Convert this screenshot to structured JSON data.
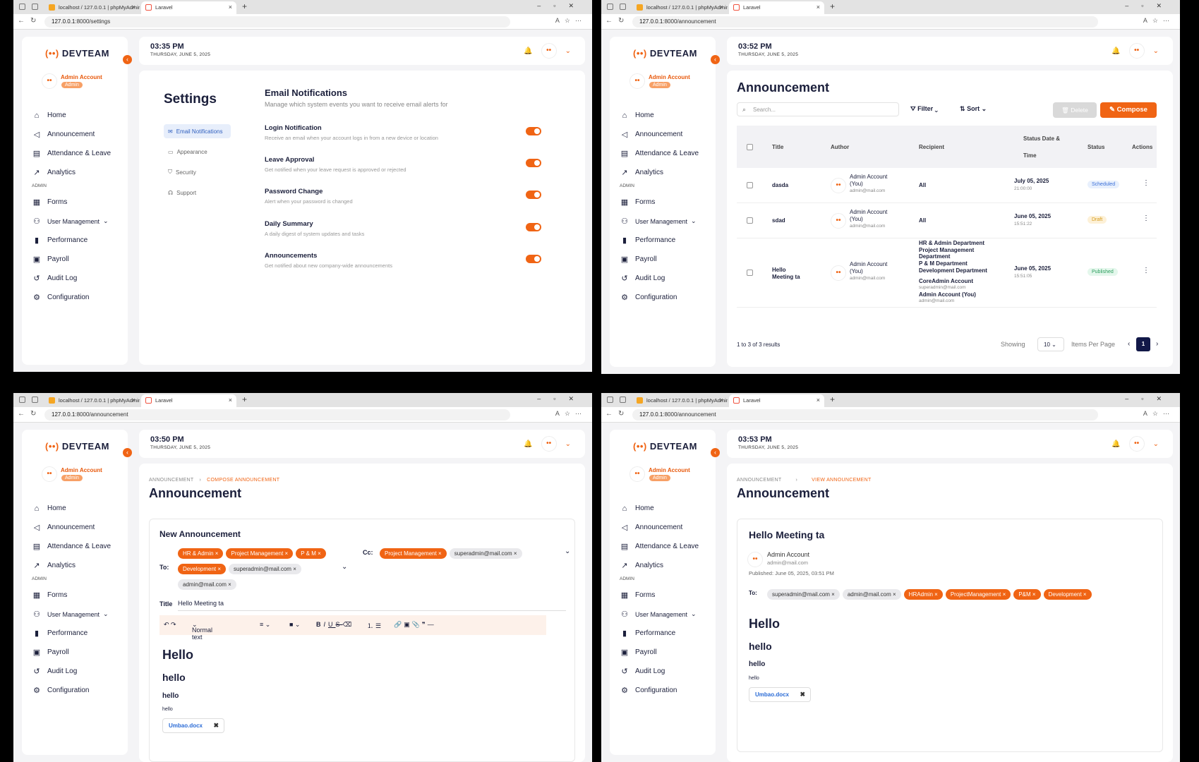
{
  "browser": {
    "tab1": "localhost / 127.0.0.1 | phpMyAdmin",
    "tab2": "Laravel",
    "url_host": "127.0.0.1",
    "url_settings": ":8000/settings",
    "url_announcement": ":8000/announcement"
  },
  "brand": {
    "prefix": "(••)",
    "name": "DEVTEAM",
    "accent": "#f06414"
  },
  "profile": {
    "name": "Admin Account",
    "role": "Admin"
  },
  "menu": {
    "home": "Home",
    "announcement": "Announcement",
    "attendance": "Attendance & Leave",
    "analytics": "Analytics",
    "admin_section": "ADMIN",
    "forms": "Forms",
    "user_mgmt": "User Management",
    "performance": "Performance",
    "payroll": "Payroll",
    "audit": "Audit Log",
    "configuration": "Configuration"
  },
  "date": "THURSDAY, JUNE 5, 2025",
  "q1": {
    "time": "03:35 PM",
    "title": "Settings",
    "nav": [
      "Email Notifications",
      "Appearance",
      "Security",
      "Support"
    ],
    "section_title": "Email Notifications",
    "section_sub": "Manage which system events you want to receive email alerts for",
    "options": [
      {
        "title": "Login Notification",
        "desc": "Receive an email when your account logs in from a new device or location",
        "enabled": true
      },
      {
        "title": "Leave Approval",
        "desc": "Get notified when your leave request is approved or rejected",
        "enabled": true
      },
      {
        "title": "Password Change",
        "desc": "Alert when your password is changed",
        "enabled": true
      },
      {
        "title": "Daily Summary",
        "desc": "A daily digest of system updates and tasks",
        "enabled": true
      },
      {
        "title": "Announcements",
        "desc": "Get notified about new company-wide announcements",
        "enabled": true
      }
    ]
  },
  "q2": {
    "time": "03:52 PM",
    "title": "Announcement",
    "search_placeholder": "Search...",
    "filter": "Filter",
    "sort": "Sort",
    "delete": "Delete",
    "compose": "Compose",
    "columns": {
      "title": "Title",
      "author": "Author",
      "recipient": "Recipient",
      "status_date_1": "Status Date &",
      "status_date_2": "Time",
      "status": "Status",
      "actions": "Actions"
    },
    "rows": [
      {
        "title": "dasda",
        "author1": "Admin Account",
        "author2": "(You)",
        "email": "admin@mail.com",
        "recipient": "All",
        "date": "July 05, 2025",
        "time": "21:00:00",
        "status": "Scheduled"
      },
      {
        "title": "sdad",
        "author1": "Admin Account",
        "author2": "(You)",
        "email": "admin@mail.com",
        "recipient": "All",
        "date": "June 05, 2025",
        "time": "15:51:22",
        "status": "Draft"
      },
      {
        "title1": "Hello",
        "title2": "Meeting ta",
        "author1": "Admin Account",
        "author2": "(You)",
        "email": "admin@mail.com",
        "recipients": [
          "HR & Admin Department",
          "Project Management",
          "Department",
          "P & M Department",
          "Development Department"
        ],
        "user1": "CoreAdmin Account",
        "user1_email": "superadmin@mail.com",
        "user2": "Admin Account (You)",
        "user2_email": "admin@mail.com",
        "date": "June 05, 2025",
        "time": "15:51:05",
        "status": "Published"
      }
    ],
    "results": "1 to 3 of 3 results",
    "showing": "Showing",
    "per_page": "10",
    "items_per_page": "Items Per Page",
    "page": "1"
  },
  "q3": {
    "time": "03:50 PM",
    "crumb1": "ANNOUNCEMENT",
    "crumb2": "COMPOSE ANNOUNCEMENT",
    "title": "Announcement",
    "card_title": "New Announcement",
    "to_label": "To:",
    "cc_label": "Cc:",
    "to_chips": [
      "HR & Admin",
      "Project Management",
      "P & M",
      "Development",
      "superadmin@mail.com",
      "admin@mail.com"
    ],
    "cc_chips": [
      "Project Management",
      "superadmin@mail.com"
    ],
    "title_label": "Title",
    "title_value": "Hello Meeting ta",
    "format": "Normal text",
    "h1": "Hello",
    "h2": "hello",
    "h3": "hello",
    "p": "hello",
    "file": "Umbao.docx"
  },
  "q4": {
    "time": "03:53 PM",
    "crumb1": "ANNOUNCEMENT",
    "crumb2": "VIEW ANNOUNCEMENT",
    "title": "Announcement",
    "card_title": "Hello Meeting ta",
    "author": "Admin Account",
    "author_email": "admin@mail.com",
    "published": "Published: June 05, 2025, 03:51 PM",
    "to_label": "To:",
    "to_chips_gray": [
      "superadmin@mail.com",
      "admin@mail.com"
    ],
    "to_chips_orange": [
      "HRAdmin",
      "ProjectManagement",
      "P&M",
      "Development"
    ],
    "h1": "Hello",
    "h2": "hello",
    "h3": "hello",
    "p": "hello",
    "file": "Umbao.docx"
  }
}
